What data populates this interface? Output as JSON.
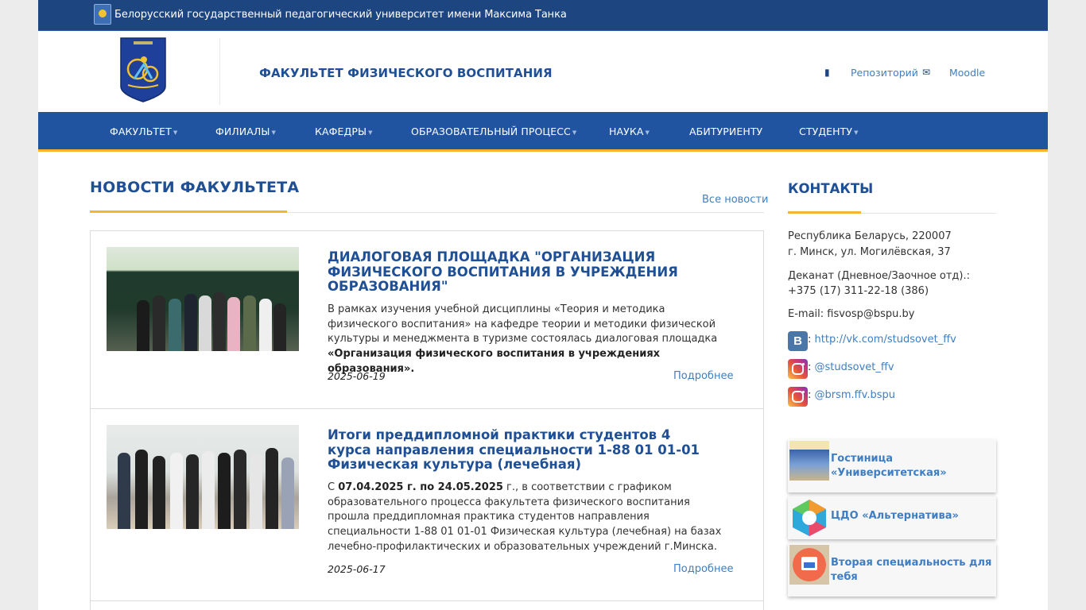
{
  "university": {
    "name": "Белорусский государственный педагогический университет имени Максима Танка"
  },
  "header": {
    "faculty_title": "ФАКУЛЬТЕТ ФИЗИЧЕСКОГО ВОСПИТАНИЯ",
    "links": [
      {
        "icon": "book-icon",
        "label": "Репозиторий"
      },
      {
        "icon": "envelope-icon",
        "label": "Moodle"
      }
    ]
  },
  "nav": {
    "items": [
      {
        "label": "ФАКУЛЬТЕТ",
        "has_dropdown": true
      },
      {
        "label": "ФИЛИАЛЫ",
        "has_dropdown": true
      },
      {
        "label": "КАФЕДРЫ",
        "has_dropdown": true
      },
      {
        "label": "ОБРАЗОВАТЕЛЬНЫЙ ПРОЦЕСС",
        "has_dropdown": true
      },
      {
        "label": "НАУКА",
        "has_dropdown": true
      },
      {
        "label": "АБИТУРИЕНТУ",
        "has_dropdown": false
      },
      {
        "label": "СТУДЕНТУ",
        "has_dropdown": true
      }
    ]
  },
  "news": {
    "heading": "НОВОСТИ ФАКУЛЬТЕТА",
    "all_news_label": "Все новости",
    "items": [
      {
        "title": "ДИАЛОГОВАЯ ПЛОЩАДКА \"ОРГАНИЗАЦИЯ ФИЗИЧЕСКОГО ВОСПИТАНИЯ В УЧРЕЖДЕНИЯ ОБРАЗОВАНИЯ\"",
        "text_plain": "В рамках изучения учебной дисциплины «Теория и методика физического воспитания» на кафедре теории и методики физической культуры и менеджмента в туризме состоялась диалоговая площадка ",
        "text_bold": "«Организация физического воспитания в учреждениях образования».",
        "date": "2025-06-19",
        "more_label": "Подробнее"
      },
      {
        "title": "Итоги преддипломной практики студентов 4 курса направления специальности 1-88 01 01-01 Физическая культура (лечебная)",
        "text_prefix": "С ",
        "text_bold": "07.04.2025 г. по 24.05.2025",
        "text_rest": " г., в соответствии с графиком образовательного процесса факультета физического воспитания прошла преддипломная практика студентов направления специальности 1-88 01 01-01 Физическая культура (лечебная) на базах лечебно-профилактических и образовательных учреждений  г.Минска.",
        "date": "2025-06-17",
        "more_label": "Подробнее"
      }
    ]
  },
  "contacts": {
    "heading": "КОНТАКТЫ",
    "address_line1": "Республика Беларусь, 220007",
    "address_line2": "г. Минск, ул. Могилёвская, 37",
    "dean_label": "Деканат (Дневное/Заочное отд).:",
    "dean_phone": "+375 (17) 311-22-18 (386)",
    "email_line": "E-mail: fisvosp@bspu.by",
    "social": [
      {
        "icon": "vk-icon",
        "separator": ": ",
        "label": "http://vk.com/studsovet_ffv"
      },
      {
        "icon": "instagram-icon",
        "separator": ": ",
        "label": "@studsovet_ffv"
      },
      {
        "icon": "instagram-icon",
        "separator": ": ",
        "label": "@brsm.ffv.bspu"
      }
    ]
  },
  "promos": [
    {
      "icon": "hotel-photo",
      "label": "Гостиница «Университетская»"
    },
    {
      "icon": "cdo-logo",
      "label": "ЦДО «Альтернатива»"
    },
    {
      "icon": "image-icon",
      "label": "Вторая специальность для тебя"
    }
  ],
  "colors": {
    "primary": "#2154a0",
    "topbar": "#1d4580",
    "accent": "#f5b52e",
    "link": "#3f7ec2",
    "heading": "#1f4f94"
  }
}
